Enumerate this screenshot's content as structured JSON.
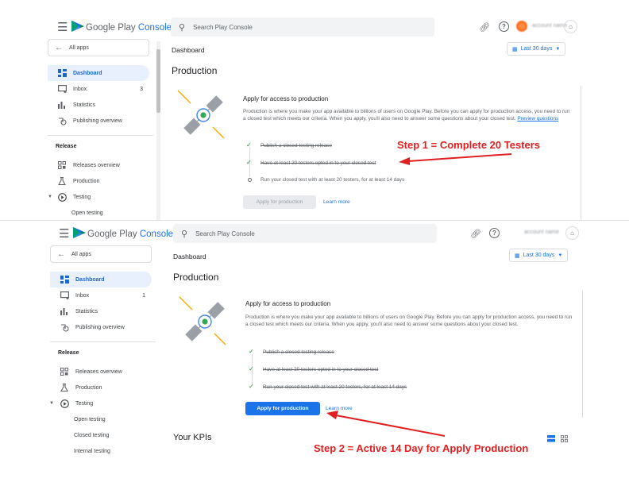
{
  "annotations": {
    "step1": "Step 1 = Complete 20 Testers",
    "step2": "Step 2 = Active 14 Day for Apply Production"
  },
  "screens": [
    {
      "header": {
        "brand_google_play": "Google Play",
        "brand_console": "Console",
        "search_placeholder": "Search Play Console",
        "account_name": "account name"
      },
      "sidebar": {
        "all_apps": "All apps",
        "items": [
          {
            "label": "Dashboard",
            "icon": "dashboard-icon",
            "active": true
          },
          {
            "label": "Inbox",
            "icon": "inbox-icon",
            "count": "3"
          },
          {
            "label": "Statistics",
            "icon": "statistics-icon"
          },
          {
            "label": "Publishing overview",
            "icon": "publishing-overview-icon"
          }
        ],
        "release_heading": "Release",
        "release_items": [
          {
            "label": "Releases overview",
            "icon": "releases-overview-icon"
          },
          {
            "label": "Production",
            "icon": "production-icon"
          },
          {
            "label": "Testing",
            "icon": "testing-icon"
          }
        ],
        "testing_sub": [
          "Open testing"
        ]
      },
      "main": {
        "dashboard_label": "Dashboard",
        "date_range": "Last 30 days",
        "production_heading": "Production",
        "card_title": "Apply for access to production",
        "card_desc": "Production is where you make your app available to billions of users on Google Play. Before you can apply for production access, you need to run a closed test which meets our criteria. When you apply, you'll also need to answer some questions about your closed test.",
        "preview_link": "Preview questions",
        "steps": [
          {
            "text": "Publish a closed testing release",
            "done": true
          },
          {
            "text": "Have at least 20 testers opted in to your closed test",
            "done": true
          },
          {
            "text": "Run your closed test with at least 20 testers, for at least 14 days",
            "done": false
          }
        ],
        "apply_button": "Apply for production",
        "learn_more": "Learn more"
      }
    },
    {
      "header": {
        "brand_google_play": "Google Play",
        "brand_console": "Console",
        "search_placeholder": "Search Play Console",
        "account_name": "account name"
      },
      "sidebar": {
        "all_apps": "All apps",
        "items": [
          {
            "label": "Dashboard",
            "icon": "dashboard-icon",
            "active": true
          },
          {
            "label": "Inbox",
            "icon": "inbox-icon",
            "count": "1"
          },
          {
            "label": "Statistics",
            "icon": "statistics-icon"
          },
          {
            "label": "Publishing overview",
            "icon": "publishing-overview-icon"
          }
        ],
        "release_heading": "Release",
        "release_items": [
          {
            "label": "Releases overview",
            "icon": "releases-overview-icon"
          },
          {
            "label": "Production",
            "icon": "production-icon"
          },
          {
            "label": "Testing",
            "icon": "testing-icon"
          }
        ],
        "testing_sub": [
          "Open testing",
          "Closed testing",
          "Internal testing"
        ]
      },
      "main": {
        "dashboard_label": "Dashboard",
        "date_range": "Last 30 days",
        "production_heading": "Production",
        "card_title": "Apply for access to production",
        "card_desc": "Production is where you make your app available to billions of users on Google Play. Before you can apply for production access, you need to run a closed test which meets our criteria. When you apply, you'll also need to answer some questions about your closed test.",
        "steps": [
          {
            "text": "Publish a closed testing release",
            "done": true
          },
          {
            "text": "Have at least 20 testers opted in to your closed test",
            "done": true
          },
          {
            "text": "Run your closed test with at least 20 testers, for at least 14 days",
            "done": true
          }
        ],
        "apply_button": "Apply for production",
        "learn_more": "Learn more",
        "kpis_heading": "Your KPIs"
      }
    }
  ]
}
